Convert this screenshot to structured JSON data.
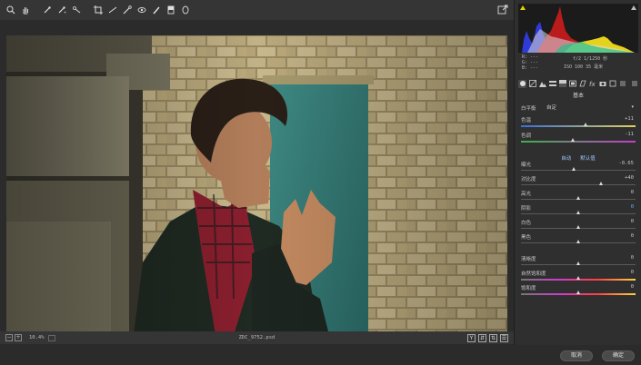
{
  "toolbar": {
    "tools": [
      "zoom-icon",
      "hand-icon",
      "white-balance-icon",
      "color-sampler-icon",
      "targeted-adjustment-icon",
      "crop-icon",
      "straighten-icon",
      "spot-removal-icon",
      "red-eye-icon",
      "adjustment-brush-icon",
      "graduated-filter-icon",
      "radial-filter-icon"
    ]
  },
  "status": {
    "zoom_value": "10.4%",
    "filename": "ZDC_9752.psd"
  },
  "histogram": {
    "r_label": "R: ---",
    "g_label": "G: ---",
    "b_label": "B: ---",
    "exif_line1": "f/2   1/1250 秒",
    "exif_line2": "ISO 100   35 毫米"
  },
  "panel": {
    "section_title": "基本",
    "wb_label": "白平衡",
    "wb_value": "自定",
    "auto_label": "自动",
    "default_label": "默认值",
    "sliders": [
      {
        "label": "色温",
        "value": "+11",
        "pos": 0.56,
        "colored": "temp"
      },
      {
        "label": "色调",
        "value": "-11",
        "pos": 0.45,
        "colored": "tint"
      },
      {
        "label": "曝光",
        "value": "-0.65",
        "pos": 0.46
      },
      {
        "label": "对比度",
        "value": "+40",
        "pos": 0.7
      },
      {
        "label": "高光",
        "value": "0",
        "pos": 0.5
      },
      {
        "label": "阴影",
        "value": "0",
        "pos": 0.5,
        "active": true
      },
      {
        "label": "白色",
        "value": "0",
        "pos": 0.5
      },
      {
        "label": "黑色",
        "value": "0",
        "pos": 0.5
      },
      {
        "label": "清晰度",
        "value": "0",
        "pos": 0.5
      },
      {
        "label": "自然饱和度",
        "value": "0",
        "pos": 0.5,
        "colored": "vib"
      },
      {
        "label": "饱和度",
        "value": "0",
        "pos": 0.5,
        "colored": "sat"
      }
    ]
  },
  "footer": {
    "cancel_label": "取消",
    "ok_label": "确定"
  },
  "colors": {
    "accent": "#5fb4ff"
  }
}
